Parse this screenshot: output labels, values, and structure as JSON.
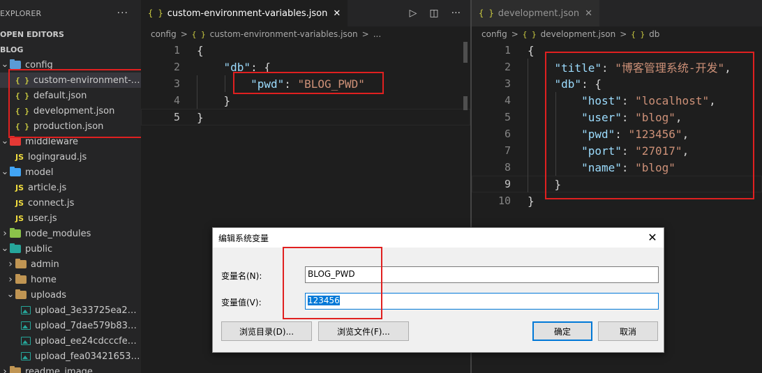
{
  "sidebar": {
    "title": "EXPLORER",
    "more": "···",
    "open_editors": "OPEN EDITORS",
    "project": "BLOG",
    "tree": [
      {
        "label": "config",
        "type": "folder",
        "depth": 0,
        "expanded": true,
        "color": "#5a9bd5"
      },
      {
        "label": "custom-environment-vari...",
        "type": "json",
        "depth": 1,
        "selected": true
      },
      {
        "label": "default.json",
        "type": "json",
        "depth": 1
      },
      {
        "label": "development.json",
        "type": "json",
        "depth": 1
      },
      {
        "label": "production.json",
        "type": "json",
        "depth": 1
      },
      {
        "label": "middleware",
        "type": "folder",
        "depth": 0,
        "expanded": true,
        "color": "#e53935"
      },
      {
        "label": "logingraud.js",
        "type": "js",
        "depth": 1
      },
      {
        "label": "model",
        "type": "folder",
        "depth": 0,
        "expanded": true,
        "color": "#42a5f5"
      },
      {
        "label": "article.js",
        "type": "js",
        "depth": 1
      },
      {
        "label": "connect.js",
        "type": "js",
        "depth": 1
      },
      {
        "label": "user.js",
        "type": "js",
        "depth": 1
      },
      {
        "label": "node_modules",
        "type": "folder",
        "depth": 0,
        "expanded": false,
        "color": "#8bc34a"
      },
      {
        "label": "public",
        "type": "folder",
        "depth": 0,
        "expanded": true,
        "color": "#26a69a"
      },
      {
        "label": "admin",
        "type": "folder",
        "depth": 1,
        "expanded": false,
        "color": "#c09553"
      },
      {
        "label": "home",
        "type": "folder",
        "depth": 1,
        "expanded": false,
        "color": "#c09553"
      },
      {
        "label": "uploads",
        "type": "folder",
        "depth": 1,
        "expanded": true,
        "color": "#c09553"
      },
      {
        "label": "upload_3e33725ea2279...",
        "type": "image",
        "depth": 2
      },
      {
        "label": "upload_7dae579b83c78...",
        "type": "image",
        "depth": 2
      },
      {
        "label": "upload_ee24cdcccfe441...",
        "type": "image",
        "depth": 2
      },
      {
        "label": "upload_fea03421653af7...",
        "type": "image",
        "depth": 2
      },
      {
        "label": "readme_image",
        "type": "folder",
        "depth": 0,
        "expanded": false,
        "color": "#c09553"
      }
    ]
  },
  "left_editor": {
    "tab": {
      "icon": "{ }",
      "label": "custom-environment-variables.json",
      "close": "✕"
    },
    "actions": {
      "run": "▷",
      "split": "◫",
      "more": "···"
    },
    "breadcrumb": [
      "config",
      ">",
      "{ }",
      "custom-environment-variables.json",
      ">",
      "..."
    ],
    "lines": [
      {
        "n": "1",
        "tokens": [
          {
            "t": "{",
            "c": "p"
          }
        ]
      },
      {
        "n": "2",
        "tokens": [
          {
            "t": "    ",
            "c": "p"
          },
          {
            "t": "\"db\"",
            "c": "k"
          },
          {
            "t": ": {",
            "c": "p"
          }
        ]
      },
      {
        "n": "3",
        "tokens": [
          {
            "t": "        ",
            "c": "p"
          },
          {
            "t": "\"pwd\"",
            "c": "k"
          },
          {
            "t": ": ",
            "c": "p"
          },
          {
            "t": "\"BLOG_PWD\"",
            "c": "s"
          }
        ]
      },
      {
        "n": "4",
        "tokens": [
          {
            "t": "    }",
            "c": "p"
          }
        ]
      },
      {
        "n": "5",
        "tokens": [
          {
            "t": "}",
            "c": "p"
          }
        ]
      }
    ],
    "current_line": "5"
  },
  "right_editor": {
    "tab": {
      "icon": "{ }",
      "label": "development.json",
      "close": "✕"
    },
    "breadcrumb": [
      "config",
      ">",
      "{ }",
      "development.json",
      ">",
      "{ }",
      "db"
    ],
    "lines": [
      {
        "n": "1",
        "tokens": [
          {
            "t": "{",
            "c": "p"
          }
        ]
      },
      {
        "n": "2",
        "tokens": [
          {
            "t": "    ",
            "c": "p"
          },
          {
            "t": "\"title\"",
            "c": "k"
          },
          {
            "t": ": ",
            "c": "p"
          },
          {
            "t": "\"博客管理系统-开发\"",
            "c": "s"
          },
          {
            "t": ",",
            "c": "p"
          }
        ]
      },
      {
        "n": "3",
        "tokens": [
          {
            "t": "    ",
            "c": "p"
          },
          {
            "t": "\"db\"",
            "c": "k"
          },
          {
            "t": ": {",
            "c": "p"
          }
        ]
      },
      {
        "n": "4",
        "tokens": [
          {
            "t": "        ",
            "c": "p"
          },
          {
            "t": "\"host\"",
            "c": "k"
          },
          {
            "t": ": ",
            "c": "p"
          },
          {
            "t": "\"localhost\"",
            "c": "s"
          },
          {
            "t": ",",
            "c": "p"
          }
        ]
      },
      {
        "n": "5",
        "tokens": [
          {
            "t": "        ",
            "c": "p"
          },
          {
            "t": "\"user\"",
            "c": "k"
          },
          {
            "t": ": ",
            "c": "p"
          },
          {
            "t": "\"blog\"",
            "c": "s"
          },
          {
            "t": ",",
            "c": "p"
          }
        ]
      },
      {
        "n": "6",
        "tokens": [
          {
            "t": "        ",
            "c": "p"
          },
          {
            "t": "\"pwd\"",
            "c": "k"
          },
          {
            "t": ": ",
            "c": "p"
          },
          {
            "t": "\"123456\"",
            "c": "s"
          },
          {
            "t": ",",
            "c": "p"
          }
        ]
      },
      {
        "n": "7",
        "tokens": [
          {
            "t": "        ",
            "c": "p"
          },
          {
            "t": "\"port\"",
            "c": "k"
          },
          {
            "t": ": ",
            "c": "p"
          },
          {
            "t": "\"27017\"",
            "c": "s"
          },
          {
            "t": ",",
            "c": "p"
          }
        ]
      },
      {
        "n": "8",
        "tokens": [
          {
            "t": "        ",
            "c": "p"
          },
          {
            "t": "\"name\"",
            "c": "k"
          },
          {
            "t": ": ",
            "c": "p"
          },
          {
            "t": "\"blog\"",
            "c": "s"
          }
        ]
      },
      {
        "n": "9",
        "tokens": [
          {
            "t": "    }",
            "c": "p"
          }
        ]
      },
      {
        "n": "10",
        "tokens": [
          {
            "t": "}",
            "c": "p"
          }
        ]
      }
    ],
    "current_line": "9"
  },
  "dialog": {
    "title": "编辑系统变量",
    "close": "✕",
    "name_label": "变量名(N):",
    "name_value": "BLOG_PWD",
    "value_label": "变量值(V):",
    "value_value": "123456",
    "browse_dir": "浏览目录(D)...",
    "browse_file": "浏览文件(F)...",
    "ok": "确定",
    "cancel": "取消"
  },
  "colors": {
    "highlight_box": "#e02020",
    "json_key": "#9cdcfe",
    "json_string": "#ce9178",
    "accent": "#0078d7"
  }
}
